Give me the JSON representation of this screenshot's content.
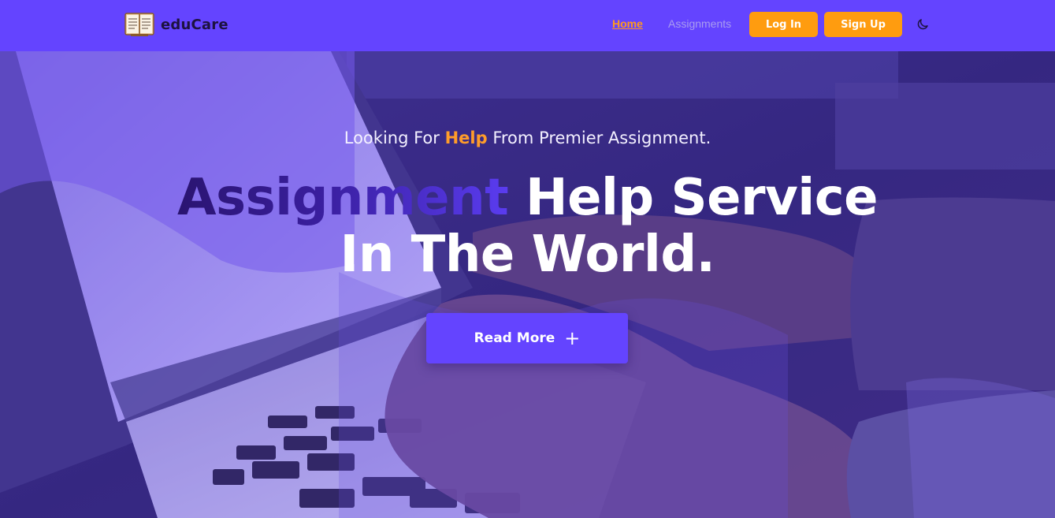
{
  "brand": {
    "name": "eduCare",
    "logo_icon": "open-book-icon"
  },
  "nav": {
    "home": "Home",
    "assignments": "Assignments",
    "login": "Log In",
    "signup": "Sign Up",
    "theme_icon": "moon-icon"
  },
  "hero": {
    "tagline_before": "Looking For ",
    "tagline_highlight": "Help",
    "tagline_after": " From Premier Assignment.",
    "headline_accent": "Assignment",
    "headline_rest": " Help Service",
    "headline_line2": "In The World.",
    "cta_label": "Read More",
    "cta_icon": "+"
  },
  "colors": {
    "primary": "#6444ff",
    "accent": "#ff9c0f",
    "brand_text": "#1d1240"
  }
}
